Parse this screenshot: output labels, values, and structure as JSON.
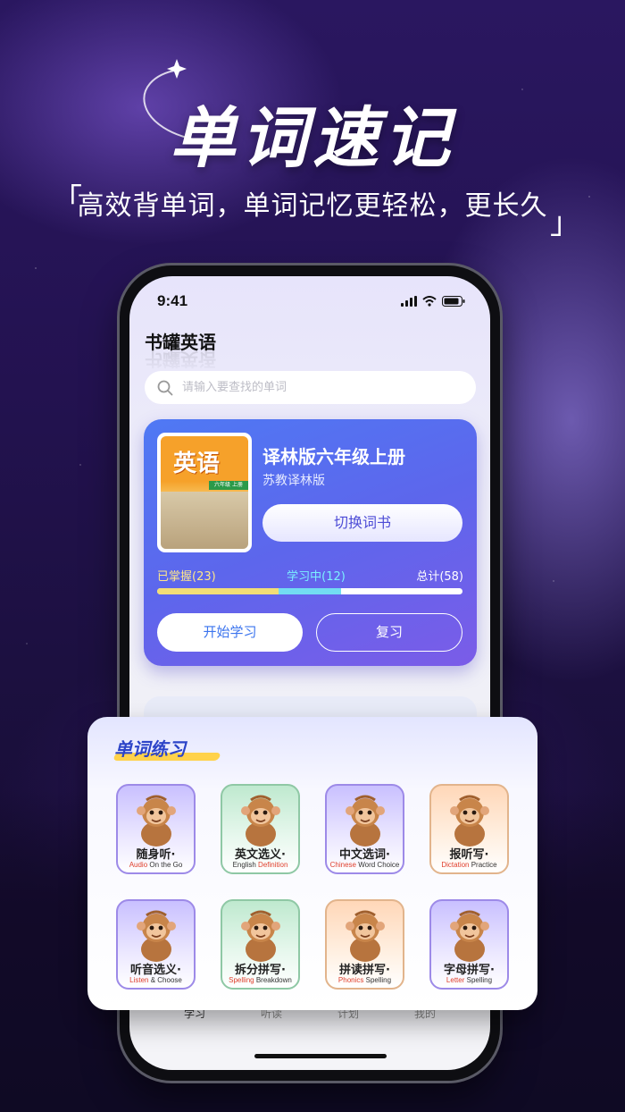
{
  "header": {
    "headline": "单词速记",
    "tagline": "高效背单词，单词记忆更轻松，更长久",
    "bracket_open": "「",
    "bracket_close": "」"
  },
  "status_bar": {
    "time": "9:41"
  },
  "app": {
    "title": "书罐英语",
    "search_placeholder": "请输入要查找的单词"
  },
  "book": {
    "cover_title": "英语",
    "cover_grade": "六年级 上册",
    "name": "译林版六年级上册",
    "publisher": "苏教译林版",
    "switch_label": "切换词书",
    "progress": {
      "mastered_label": "已掌握(23)",
      "learning_label": "学习中(12)",
      "total_label": "总计(58)",
      "mastered": 23,
      "learning": 12,
      "total": 58
    },
    "start_label": "开始学习",
    "review_label": "复习"
  },
  "practice": {
    "title": "单词练习",
    "items": [
      {
        "cn": "随身听·",
        "en_hl": "Audio",
        "en_rest": " On the Go",
        "theme": "purple"
      },
      {
        "cn": "英文选义·",
        "en_hl": "English",
        "en_rest": " Definition",
        "theme": "mint",
        "hl_second": true
      },
      {
        "cn": "中文选词·",
        "en_hl": "Chinese",
        "en_rest": " Word Choice",
        "theme": "purple"
      },
      {
        "cn": "报听写·",
        "en_hl": "Dictation",
        "en_rest": " Practice",
        "theme": "peach"
      },
      {
        "cn": "听音选义·",
        "en_hl": "Listen",
        "en_rest": " & Choose",
        "theme": "purple"
      },
      {
        "cn": "拆分拼写·",
        "en_hl": "Spelling",
        "en_rest": " Breakdown",
        "theme": "mint"
      },
      {
        "cn": "拼读拼写·",
        "en_hl": "Phonics",
        "en_rest": " Spelling",
        "theme": "peach"
      },
      {
        "cn": "字母拼写·",
        "en_hl": "Letter",
        "en_rest": " Spelling",
        "theme": "purple"
      }
    ]
  },
  "tabbar": {
    "tabs": [
      {
        "label": "学习",
        "active": true
      },
      {
        "label": "听读",
        "active": false
      },
      {
        "label": "计划",
        "active": false
      },
      {
        "label": "我的",
        "active": false
      }
    ]
  },
  "colors": {
    "accent": "#5d66ec",
    "highlight": "#e0402e",
    "mastered": "#f2de76",
    "learning": "#72dcf2"
  }
}
